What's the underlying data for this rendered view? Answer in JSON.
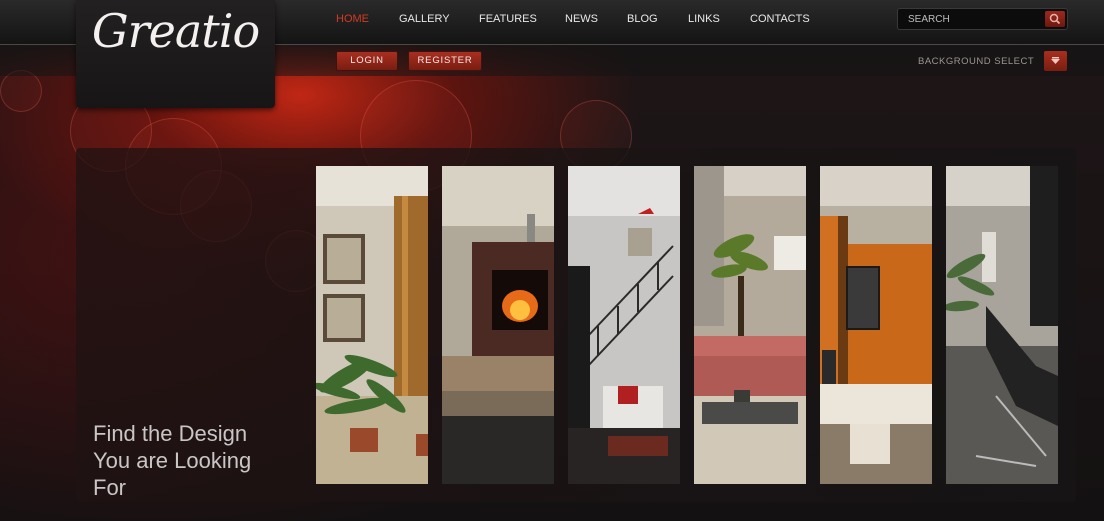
{
  "logo": {
    "text": "Greatio"
  },
  "nav": {
    "items": [
      {
        "label": "HOME",
        "active": true
      },
      {
        "label": "GALLERY",
        "active": false
      },
      {
        "label": "FEATURES",
        "active": false
      },
      {
        "label": "NEWS",
        "active": false
      },
      {
        "label": "BLOG",
        "active": false
      },
      {
        "label": "LINKS",
        "active": false
      },
      {
        "label": "CONTACTS",
        "active": false
      }
    ]
  },
  "search": {
    "placeholder": "SEARCH",
    "icon": "magnifier-icon"
  },
  "account": {
    "login_label": "LOGIN",
    "register_label": "REGISTER"
  },
  "background_select": {
    "label": "BACKGROUND SELECT",
    "icon": "arrow-down-icon"
  },
  "hero": {
    "tagline_lines": [
      "Find the Design",
      "You are Looking",
      "For"
    ],
    "tiles": [
      {
        "name": "hallway-plants-photo"
      },
      {
        "name": "fireplace-living-room-photo"
      },
      {
        "name": "staircase-lounge-photo"
      },
      {
        "name": "red-sofa-living-room-photo"
      },
      {
        "name": "tv-wall-living-room-photo"
      },
      {
        "name": "black-lounge-chair-photo"
      }
    ]
  },
  "colors": {
    "accent": "#d23a22",
    "button": "#a82f1f",
    "background": "#161213"
  }
}
